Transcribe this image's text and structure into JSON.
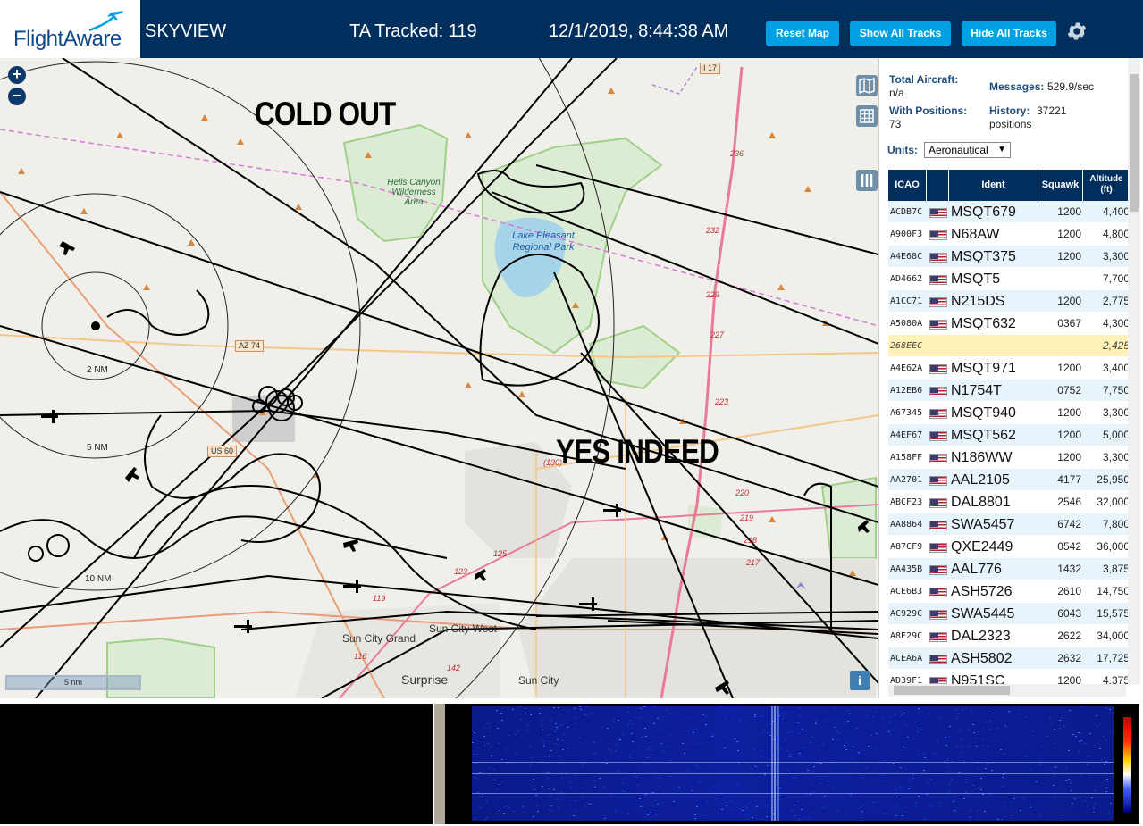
{
  "header": {
    "logo_text": "FlightAware",
    "title": "SKYVIEW",
    "tracked": "TA Tracked: 119",
    "datetime": "12/1/2019, 8:44:38 AM",
    "reset_map": "Reset Map",
    "show_all_tracks": "Show All Tracks",
    "hide_all_tracks": "Hide All Tracks"
  },
  "map": {
    "overlay_cold": "COLD OUT",
    "overlay_yes": "YES INDEED",
    "zoom_in": "+",
    "zoom_out": "−",
    "scale": "5 nm",
    "info": "i",
    "labels": {
      "sun_city_grand": "Sun City Grand",
      "sun_city_west": "Sun City West",
      "surprise": "Surprise",
      "sun_city": "Sun City",
      "hells_canyon": "Hells Canyon Wilderness Area",
      "lake_pleasant": "Lake Pleasant Regional Park",
      "ring_2": "2 NM",
      "ring_5": "5 NM",
      "ring_10": "10 NM",
      "az74": "AZ 74",
      "i17": "I 17",
      "us60": "US 60"
    }
  },
  "stats": {
    "total_aircraft_label": "Total Aircraft:",
    "total_aircraft_value": "n/a",
    "messages_label": "Messages:",
    "messages_value": "529.9/sec",
    "with_positions_label": "With Positions:",
    "with_positions_value": "73",
    "history_label": "History:",
    "history_value": "37221",
    "history_unit": "positions",
    "units_label": "Units:",
    "units_value": "Aeronautical"
  },
  "table": {
    "headers": {
      "icao": "ICAO",
      "ident": "Ident",
      "squawk": "Squawk",
      "altitude": "Altitude (ft)"
    },
    "rows": [
      {
        "icao": "ACDB7C",
        "ident": "MSQT679",
        "squawk": "1200",
        "alt": "4,400"
      },
      {
        "icao": "A900F3",
        "ident": "N68AW",
        "squawk": "1200",
        "alt": "4,800"
      },
      {
        "icao": "A4E68C",
        "ident": "MSQT375",
        "squawk": "1200",
        "alt": "3,300"
      },
      {
        "icao": "AD4662",
        "ident": "MSQT5",
        "squawk": "",
        "alt": "7,700"
      },
      {
        "icao": "A1CC71",
        "ident": "N215DS",
        "squawk": "1200",
        "alt": "2,775"
      },
      {
        "icao": "A5080A",
        "ident": "MSQT632",
        "squawk": "0367",
        "alt": "4,300"
      },
      {
        "icao": "268EEC",
        "ident": "",
        "squawk": "",
        "alt": "2,425"
      },
      {
        "icao": "A4E62A",
        "ident": "MSQT971",
        "squawk": "1200",
        "alt": "3,400"
      },
      {
        "icao": "A12EB6",
        "ident": "N1754T",
        "squawk": "0752",
        "alt": "7,750"
      },
      {
        "icao": "A67345",
        "ident": "MSQT940",
        "squawk": "1200",
        "alt": "3,300"
      },
      {
        "icao": "A4EF67",
        "ident": "MSQT562",
        "squawk": "1200",
        "alt": "5,000"
      },
      {
        "icao": "A158FF",
        "ident": "N186WW",
        "squawk": "1200",
        "alt": "3,300"
      },
      {
        "icao": "AA2701",
        "ident": "AAL2105",
        "squawk": "4177",
        "alt": "25,950"
      },
      {
        "icao": "ABCF23",
        "ident": "DAL8801",
        "squawk": "2546",
        "alt": "32,000"
      },
      {
        "icao": "AA8864",
        "ident": "SWA5457",
        "squawk": "6742",
        "alt": "7,800"
      },
      {
        "icao": "A87CF9",
        "ident": "QXE2449",
        "squawk": "0542",
        "alt": "36,000"
      },
      {
        "icao": "AA435B",
        "ident": "AAL776",
        "squawk": "1432",
        "alt": "3,875"
      },
      {
        "icao": "ACE6B3",
        "ident": "ASH5726",
        "squawk": "2610",
        "alt": "14,750"
      },
      {
        "icao": "AC929C",
        "ident": "SWA5445",
        "squawk": "6043",
        "alt": "15,575"
      },
      {
        "icao": "A8E29C",
        "ident": "DAL2323",
        "squawk": "2622",
        "alt": "34,000"
      },
      {
        "icao": "ACEA6A",
        "ident": "ASH5802",
        "squawk": "2632",
        "alt": "17,725"
      },
      {
        "icao": "AD39F1",
        "ident": "N951SC",
        "squawk": "1200",
        "alt": "4,375"
      }
    ]
  },
  "colors": {
    "header_bg": "#002f5d",
    "button_bg": "#00a0e2",
    "row_alt": "#e8f4fb",
    "row_highlight": "#fff1b8"
  }
}
